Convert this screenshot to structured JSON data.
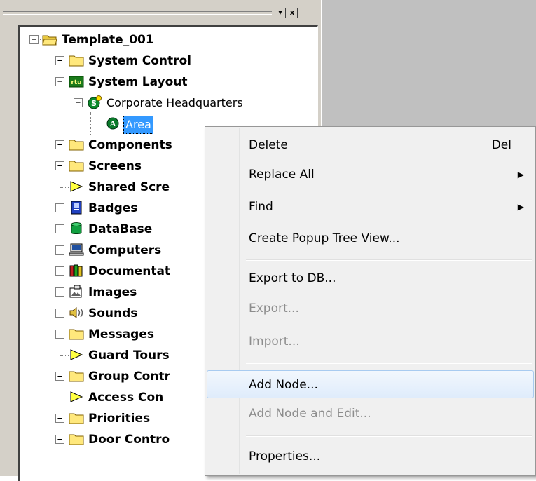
{
  "tree": {
    "root": {
      "label": "Template_001",
      "expander": "−"
    },
    "nodes": [
      {
        "label": "System Control",
        "expander": "+",
        "icon": "folder-icon"
      },
      {
        "label": "System Layout",
        "expander": "−",
        "icon": "rtu-icon",
        "icon_text": "rtu"
      },
      {
        "label": "Corporate Headquarters",
        "expander": "−",
        "icon": "site-icon",
        "icon_text": "S"
      },
      {
        "label": "Area",
        "icon": "area-icon",
        "icon_text": "A",
        "selected": true
      },
      {
        "label": "Components",
        "expander": "+",
        "icon": "folder-icon"
      },
      {
        "label": "Screens",
        "expander": "+",
        "icon": "folder-icon"
      },
      {
        "label": "Shared Scre",
        "icon": "play-triangle-icon"
      },
      {
        "label": "Badges",
        "expander": "+",
        "icon": "badge-icon"
      },
      {
        "label": "DataBase",
        "expander": "+",
        "icon": "database-icon"
      },
      {
        "label": "Computers",
        "expander": "+",
        "icon": "computer-icon"
      },
      {
        "label": "Documentat",
        "expander": "+",
        "icon": "books-icon"
      },
      {
        "label": "Images",
        "expander": "+",
        "icon": "images-icon"
      },
      {
        "label": "Sounds",
        "expander": "+",
        "icon": "speaker-icon"
      },
      {
        "label": "Messages",
        "expander": "+",
        "icon": "folder-icon"
      },
      {
        "label": "Guard Tours",
        "icon": "play-triangle-icon"
      },
      {
        "label": "Group Contr",
        "expander": "+",
        "icon": "folder-icon"
      },
      {
        "label": "Access Con",
        "icon": "play-triangle-icon"
      },
      {
        "label": "Priorities",
        "expander": "+",
        "icon": "folder-icon"
      },
      {
        "label": "Door Contro",
        "expander": "+",
        "icon": "folder-icon"
      }
    ]
  },
  "panel_buttons": {
    "minimize": "▾",
    "close": "x"
  },
  "context_menu": {
    "items": [
      {
        "label": "Delete",
        "shortcut": "Del"
      },
      {
        "label": "Replace All",
        "submenu": "▶"
      },
      {
        "label": "Find",
        "submenu": "▶"
      },
      {
        "label": "Create Popup Tree View..."
      },
      {
        "label": "Export to DB..."
      },
      {
        "label": "Export...",
        "disabled": true
      },
      {
        "label": "Import...",
        "disabled": true
      },
      {
        "label": "Add Node...",
        "highlighted": true
      },
      {
        "label": "Add Node and Edit...",
        "disabled": true
      },
      {
        "label": "Properties..."
      }
    ]
  },
  "colors": {
    "selection": "#3399ff",
    "folder": "#ffe87c",
    "panel_bg": "#d4d0c8",
    "workspace_bg": "#c0c0c0",
    "menu_bg": "#f0f0f0",
    "menu_highlight_border": "#a8cbf0"
  }
}
